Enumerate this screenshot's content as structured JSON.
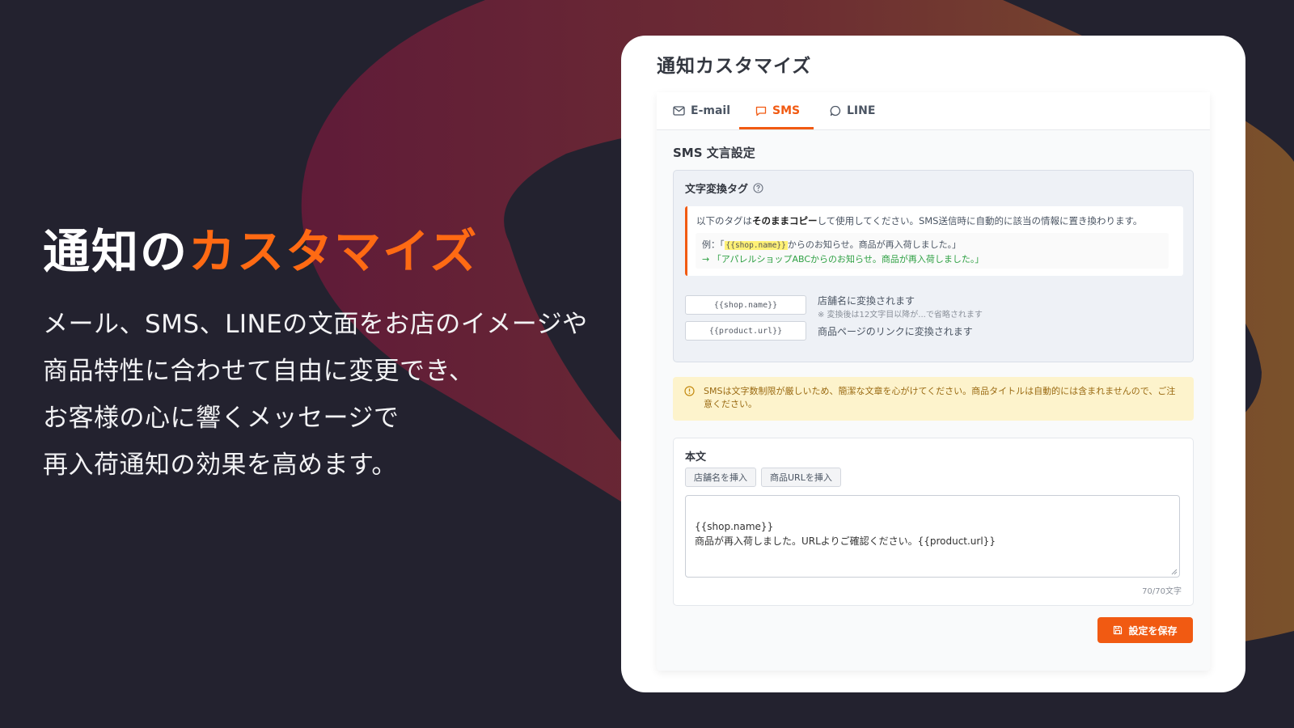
{
  "hero": {
    "title_main": "通知の",
    "title_accent": "カスタマイズ",
    "body_lines": [
      "メール、SMS、LINEの文面をお店のイメージや",
      "商品特性に合わせて自由に変更でき、",
      "お客様の心に響くメッセージで",
      "再入荷通知の効果を高めます。"
    ]
  },
  "card": {
    "title": "通知カスタマイズ",
    "tabs": [
      {
        "label": "E-mail",
        "icon": "mail-icon",
        "active": false
      },
      {
        "label": "SMS",
        "icon": "chat-icon",
        "active": true
      },
      {
        "label": "LINE",
        "icon": "speech-bubble-icon",
        "active": false
      }
    ],
    "section_title": "SMS 文言設定",
    "tags_box": {
      "heading": "文字変換タグ",
      "info": {
        "line_prefix": "以下のタグは",
        "line_bold": "そのままコピー",
        "line_suffix": "して使用してください。SMS送信時に自動的に該当の情報に置き換わります。",
        "example_prefix": "例：「",
        "example_tag": "{{shop.name}}",
        "example_suffix": "からのお知らせ。商品が再入荷しました。」",
        "example_result": "→ 「アパレルショップABCからのお知らせ。商品が再入荷しました。」"
      },
      "tags": [
        {
          "tag": "{{shop.name}}",
          "description": "店舗名に変換されます",
          "note": "※ 変換後は12文字目以降が...で省略されます"
        },
        {
          "tag": "{{product.url}}",
          "description": "商品ページのリンクに変換されます",
          "note": ""
        }
      ]
    },
    "warning": "SMSは文字数制限が厳しいため、簡潔な文章を心がけてください。商品タイトルは自動的には含まれませんので、ご注意ください。",
    "body": {
      "label": "本文",
      "insert_shop_label": "店舗名を挿入",
      "insert_url_label": "商品URLを挿入",
      "text": "{{shop.name}}\n商品が再入荷しました。URLよりご確認ください。{{product.url}}",
      "counter": "70/70文字"
    },
    "save_label": "設定を保存"
  },
  "colors": {
    "accent": "#f15a12",
    "background": "#23222f",
    "hero_accent": "#ff6a13"
  }
}
